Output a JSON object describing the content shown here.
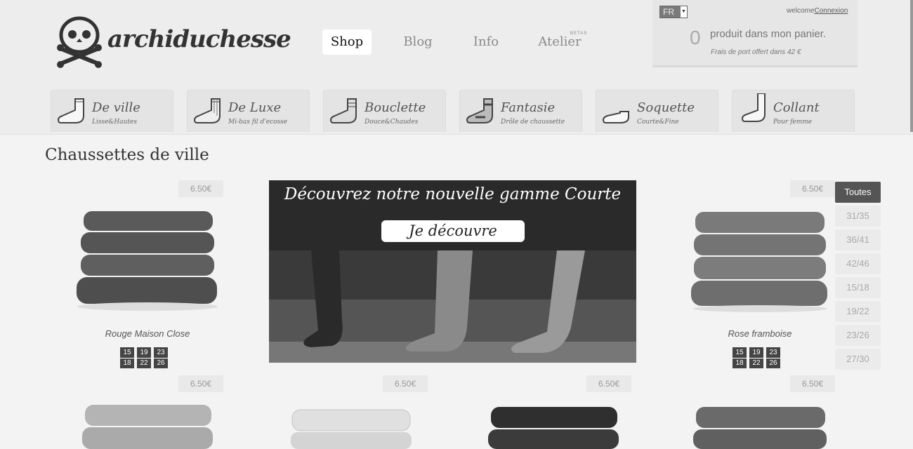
{
  "brand": {
    "name": "archiduchesse"
  },
  "nav": {
    "items": [
      {
        "label": "Shop"
      },
      {
        "label": "Blog"
      },
      {
        "label": "Info"
      },
      {
        "label": "Atelier"
      }
    ],
    "beta": "BETAS"
  },
  "account": {
    "language": "FR",
    "welcome": "welcome",
    "login": "Connexion"
  },
  "cart": {
    "count": "0",
    "text": "produit dans mon panier.",
    "shipping": "Frais de port offert dans 42 €"
  },
  "categories": [
    {
      "title": "De ville",
      "subtitle": "Lisse&Hautes"
    },
    {
      "title": "De Luxe",
      "subtitle": "Mi-bas fil d'ecosse"
    },
    {
      "title": "Bouclette",
      "subtitle": "Douce&Chaudes"
    },
    {
      "title": "Fantasie",
      "subtitle": "Drôle de chaussette"
    },
    {
      "title": "Soquette",
      "subtitle": "Courte&Fine"
    },
    {
      "title": "Collant",
      "subtitle": "Pour femme"
    }
  ],
  "page": {
    "title": "Chaussettes de ville"
  },
  "banner": {
    "title": "Découvrez notre nouvelle gamme Courte",
    "button": "Je découvre"
  },
  "products": [
    {
      "name": "Rouge Maison Close",
      "price": "6.50€",
      "sizes": [
        [
          "15",
          "18"
        ],
        [
          "19",
          "22"
        ],
        [
          "23",
          "26"
        ]
      ],
      "tone": "#5a5a5a"
    },
    {
      "name": "Rose framboise",
      "price": "6.50€",
      "sizes": [
        [
          "15",
          "18"
        ],
        [
          "19",
          "22"
        ],
        [
          "23",
          "26"
        ]
      ],
      "tone": "#7a7a7a"
    },
    {
      "price": "6.50€",
      "tone": "#b4b4b4"
    },
    {
      "price": "6.50€",
      "tone": "#d8d8d8"
    },
    {
      "price": "6.50€",
      "tone": "#333333"
    },
    {
      "price": "6.50€",
      "tone": "#6a6a6a"
    }
  ],
  "filters": [
    {
      "label": "Toutes",
      "active": true
    },
    {
      "label": "31/35"
    },
    {
      "label": "36/41"
    },
    {
      "label": "42/46"
    },
    {
      "label": "15/18"
    },
    {
      "label": "19/22"
    },
    {
      "label": "23/26"
    },
    {
      "label": "27/30"
    }
  ]
}
